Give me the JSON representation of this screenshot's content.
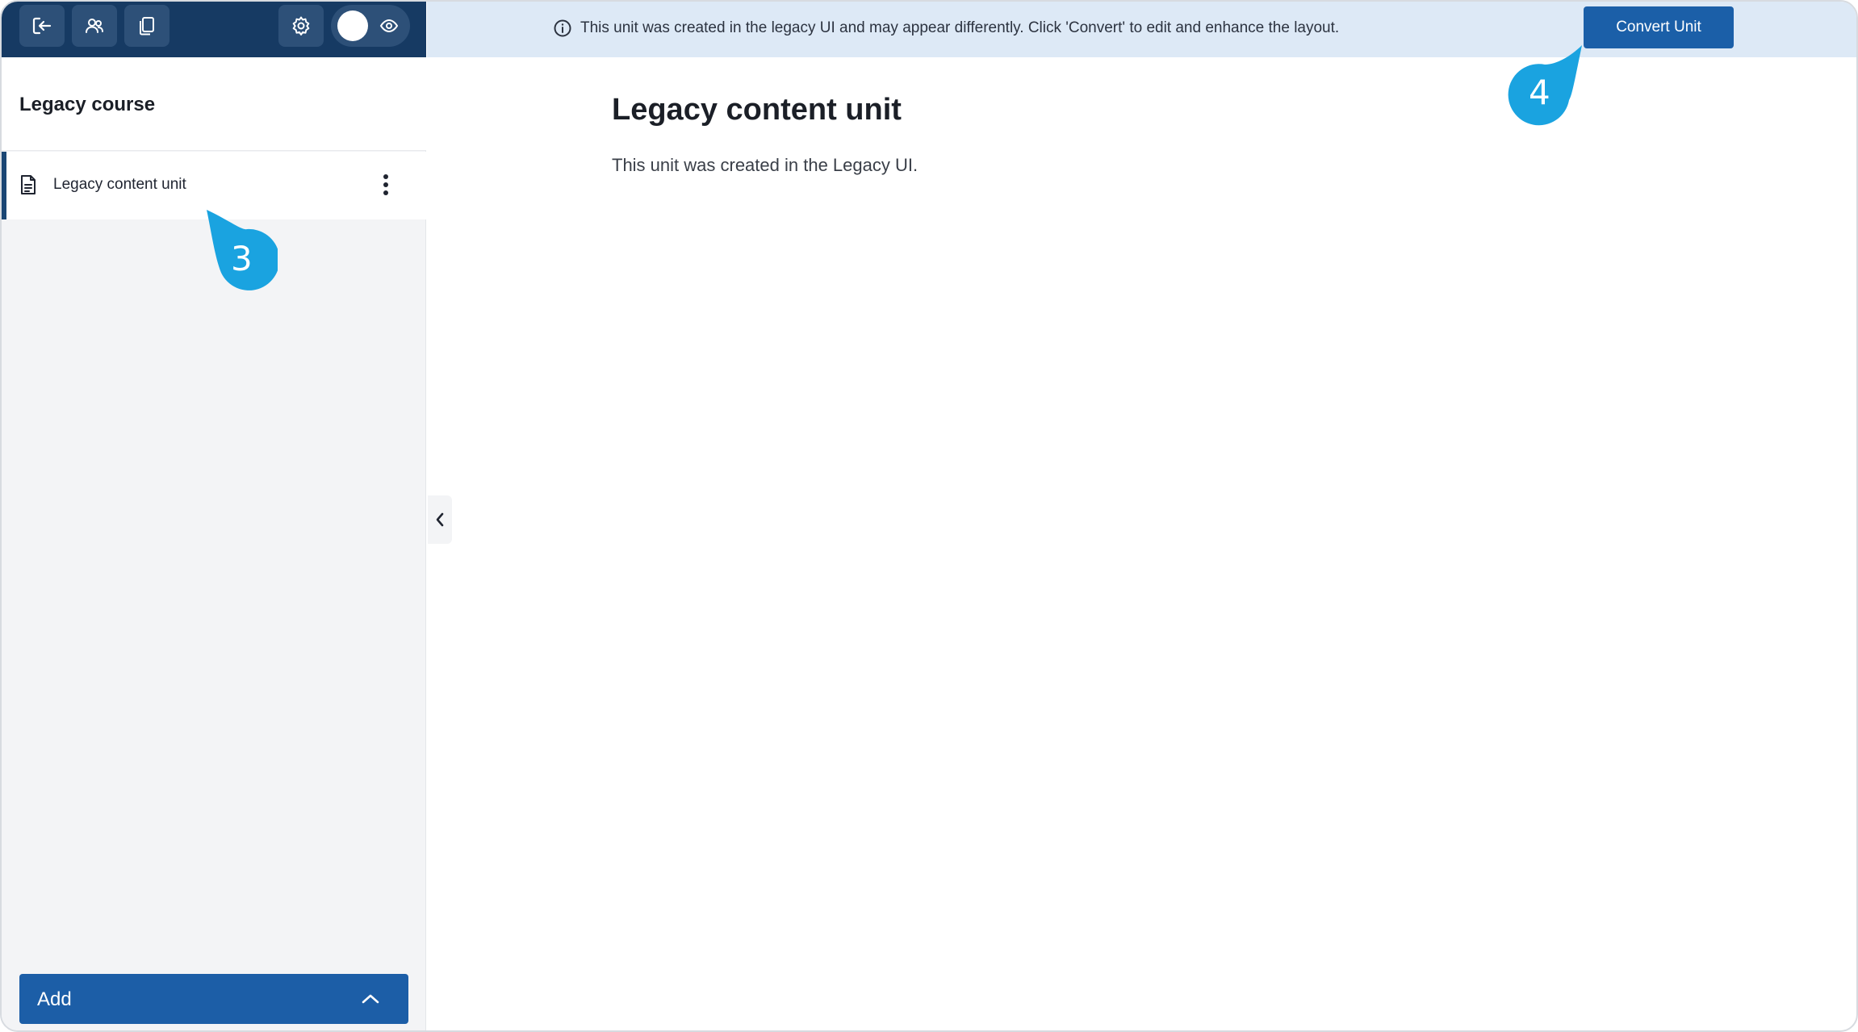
{
  "toolbar": {
    "exit_icon": "exit-icon",
    "users_icon": "users-icon",
    "copy_icon": "copy-icon",
    "settings_icon": "gear-icon",
    "preview_icon": "eye-icon"
  },
  "sidebar": {
    "course_title": "Legacy course",
    "items": [
      {
        "label": "Legacy content unit",
        "icon": "document-icon",
        "menu_icon": "more-vertical-icon"
      }
    ],
    "add_label": "Add"
  },
  "banner": {
    "text": "This unit was created in the legacy UI and may appear differently. Click 'Convert' to edit and enhance the layout.",
    "button_label": "Convert Unit"
  },
  "content": {
    "title": "Legacy content unit",
    "body": "This unit was created in the Legacy UI."
  },
  "callouts": [
    {
      "number": "3"
    },
    {
      "number": "4"
    }
  ],
  "colors": {
    "toolbar_bg": "#163a63",
    "accent": "#1c5ea7",
    "banner_bg": "#dde9f6",
    "callout": "#1aa3e0"
  }
}
